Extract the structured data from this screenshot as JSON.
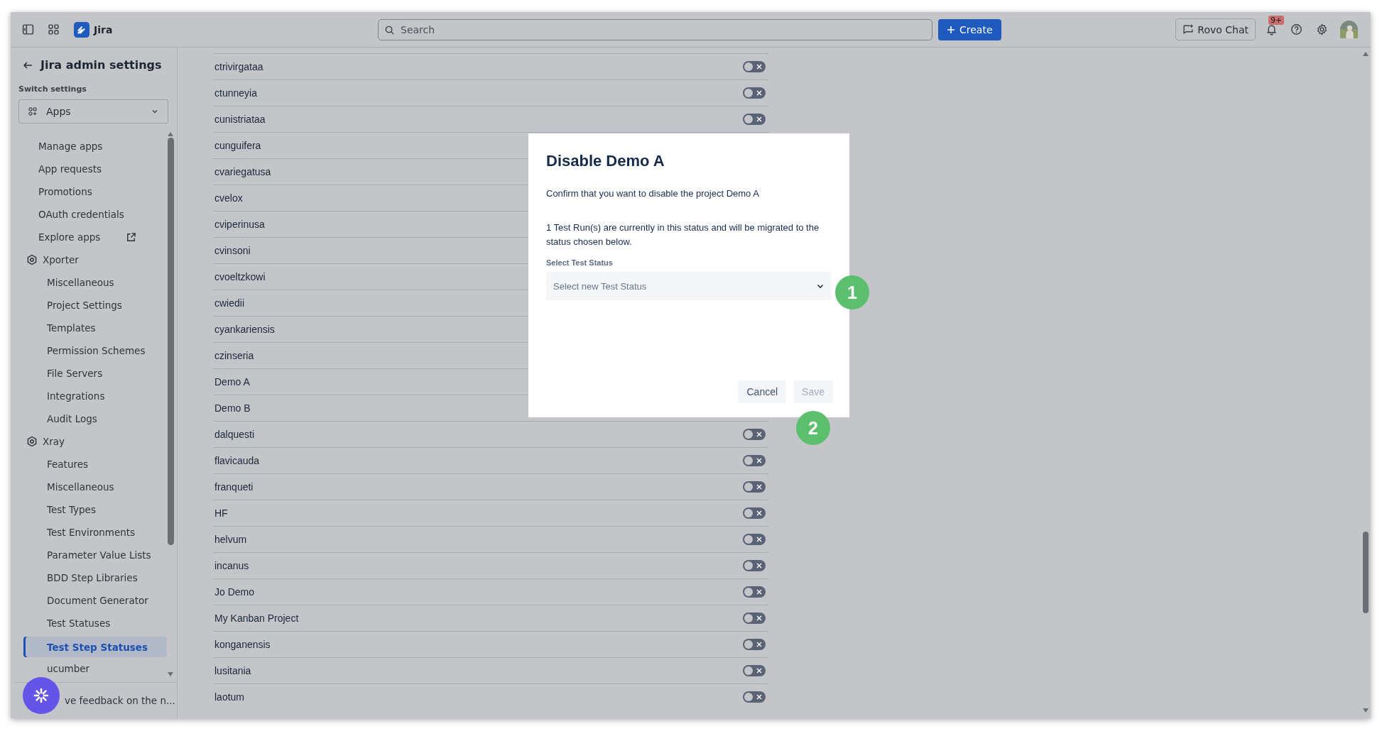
{
  "top_bar": {
    "product": "Jira",
    "search": {
      "placeholder": "Search"
    },
    "create": "Create",
    "rovo": "Rovo Chat",
    "notifications": "9+"
  },
  "sidebar": {
    "title": "Jira admin settings",
    "switch_label": "Switch settings",
    "switch_value": "Apps",
    "items": [
      {
        "label": "Manage apps",
        "kind": "link",
        "selected": false
      },
      {
        "label": "App requests",
        "kind": "link",
        "selected": false
      },
      {
        "label": "Promotions",
        "kind": "link",
        "selected": false
      },
      {
        "label": "OAuth credentials",
        "kind": "link",
        "selected": false
      },
      {
        "label": "Explore apps",
        "kind": "external",
        "selected": false
      },
      {
        "label": "Xporter",
        "kind": "group",
        "selected": false,
        "children": [
          {
            "label": "Miscellaneous",
            "selected": false
          },
          {
            "label": "Project Settings",
            "selected": false
          },
          {
            "label": "Templates",
            "selected": false
          },
          {
            "label": "Permission Schemes",
            "selected": false
          },
          {
            "label": "File Servers",
            "selected": false
          },
          {
            "label": "Integrations",
            "selected": false
          },
          {
            "label": "Audit Logs",
            "selected": false
          }
        ]
      },
      {
        "label": "Xray",
        "kind": "group",
        "selected": false,
        "children": [
          {
            "label": "Features",
            "selected": false
          },
          {
            "label": "Miscellaneous",
            "selected": false
          },
          {
            "label": "Test Types",
            "selected": false
          },
          {
            "label": "Test Environments",
            "selected": false
          },
          {
            "label": "Parameter Value Lists",
            "selected": false
          },
          {
            "label": "BDD Step Libraries",
            "selected": false
          },
          {
            "label": "Document Generator",
            "selected": false
          },
          {
            "label": "Test Statuses",
            "selected": false
          },
          {
            "label": "Test Step Statuses",
            "selected": true
          },
          {
            "label": "ucumber",
            "selected": false
          }
        ]
      }
    ],
    "feedback": "ve feedback on the n..."
  },
  "projects": [
    {
      "name": "ctrivirgataa",
      "toggle": {
        "on": false
      }
    },
    {
      "name": "ctunneyia",
      "toggle": {
        "on": false
      }
    },
    {
      "name": "cunistriataa",
      "toggle": {
        "on": false
      }
    },
    {
      "name": "cunguifera"
    },
    {
      "name": "cvariegatusa"
    },
    {
      "name": "cvelox"
    },
    {
      "name": "cviperinusa"
    },
    {
      "name": "cvinsoni"
    },
    {
      "name": "cvoeltzkowi"
    },
    {
      "name": "cwiedii"
    },
    {
      "name": "cyankariensis"
    },
    {
      "name": "czinseria"
    },
    {
      "name": "Demo A"
    },
    {
      "name": "Demo B"
    },
    {
      "name": "dalquesti",
      "toggle": {
        "on": false
      }
    },
    {
      "name": "flavicauda",
      "toggle": {
        "on": false
      }
    },
    {
      "name": "franqueti",
      "toggle": {
        "on": false
      }
    },
    {
      "name": "HF",
      "toggle": {
        "on": false
      }
    },
    {
      "name": "helvum",
      "toggle": {
        "on": false
      }
    },
    {
      "name": "incanus",
      "toggle": {
        "on": false
      }
    },
    {
      "name": "Jo Demo",
      "toggle": {
        "on": false
      }
    },
    {
      "name": "My Kanban Project",
      "toggle": {
        "on": false
      }
    },
    {
      "name": "konganensis",
      "toggle": {
        "on": false
      }
    },
    {
      "name": "lusitania",
      "toggle": {
        "on": false
      }
    },
    {
      "name": "laotum",
      "toggle": {
        "on": false
      }
    }
  ],
  "dialog": {
    "title": "Disable Demo A",
    "message": "Confirm that you want to disable the project Demo A",
    "note": "1 Test Run(s) are currently in this status and will be migrated to the status chosen below.",
    "field_label": "Select Test Status",
    "select": {
      "placeholder": "Select new Test Status"
    },
    "buttons": [
      {
        "label": "Cancel",
        "disabled": false
      },
      {
        "label": "Save",
        "disabled": true
      }
    ]
  },
  "callouts": [
    "1",
    "2"
  ]
}
